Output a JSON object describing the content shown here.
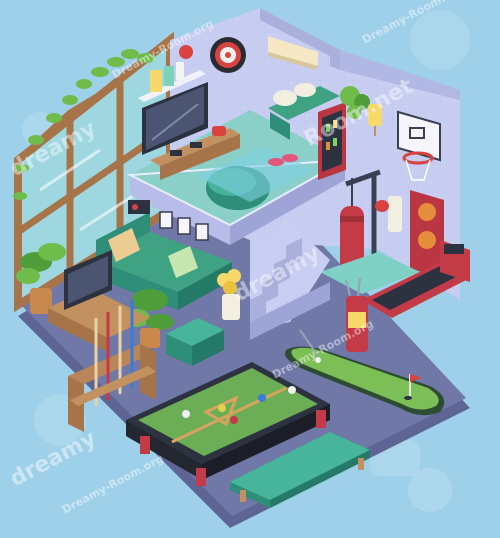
{
  "game": {
    "title": "Dreamy Room",
    "watermarks": {
      "big": "dreamy",
      "site": "Dreamy-Room.org",
      "domain": "Room.net"
    }
  },
  "palette": {
    "background": "#9fd0ea",
    "floor": "#6f78a6",
    "wall": "#c8cdf2",
    "wall_dark": "#aab0dc",
    "teal": "#46b59a",
    "wood": "#b98559",
    "red": "#c23b47",
    "pool_felt": "#6cae55",
    "putting_green": "#7cbf57"
  },
  "icons": [
    "dartboard-icon",
    "basketball-hoop-icon",
    "punching-bag-icon",
    "treadmill-icon",
    "pool-table-icon",
    "cue-rack-icon",
    "golf-bag-icon",
    "putting-green-icon",
    "sofa-icon",
    "tv-icon",
    "bed-icon",
    "fridge-icon",
    "plant-icon",
    "window-icon",
    "bench-icon",
    "ottoman-icon",
    "stairs-icon",
    "flowers-icon",
    "console-icon"
  ]
}
